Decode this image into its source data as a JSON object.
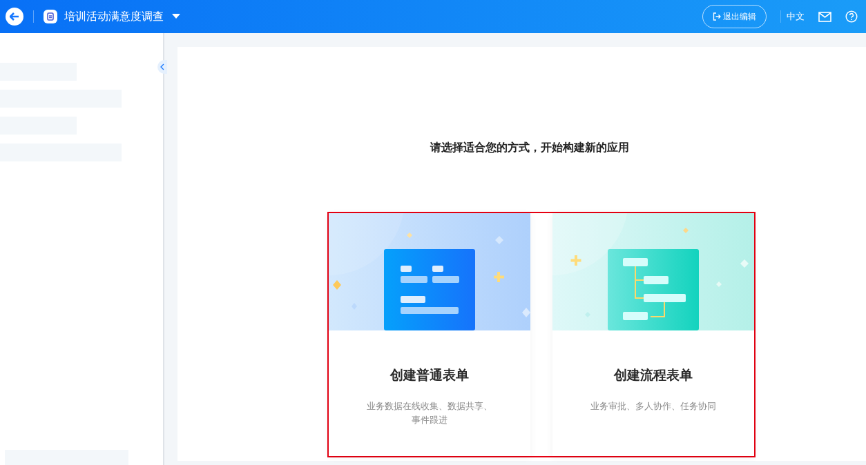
{
  "header": {
    "title": "培训活动满意度调查",
    "exit_button": "退出编辑",
    "language": "中文"
  },
  "main": {
    "heading": "请选择适合您的方式，开始构建新的应用",
    "cards": [
      {
        "kind": "form",
        "title": "创建普通表单",
        "description": "业务数据在线收集、数据共享、事件跟进"
      },
      {
        "kind": "flow",
        "title": "创建流程表单",
        "description": "业务审批、多人协作、任务协同"
      }
    ]
  }
}
